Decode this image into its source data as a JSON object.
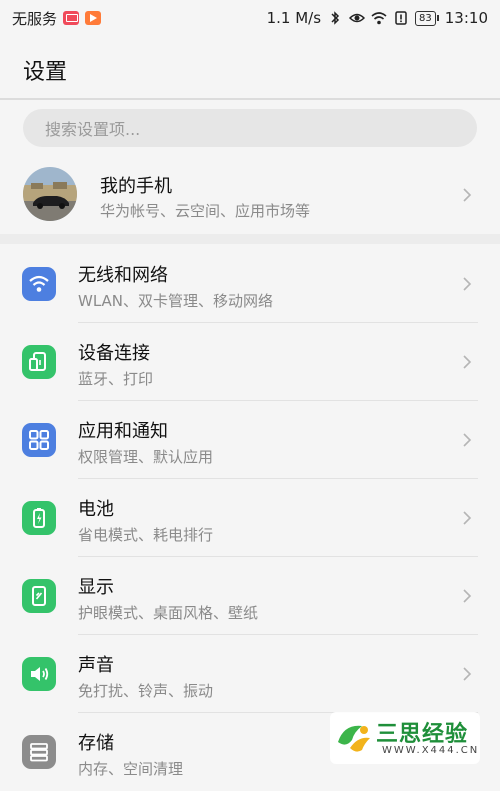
{
  "status_bar": {
    "carrier": "无服务",
    "speed": "1.1 M/s",
    "battery": "83",
    "time": "13:10"
  },
  "header": {
    "title": "设置"
  },
  "search": {
    "placeholder": "搜索设置项..."
  },
  "profile": {
    "name": "我的手机",
    "subtitle": "华为帐号、云空间、应用市场等"
  },
  "items": [
    {
      "title": "无线和网络",
      "subtitle": "WLAN、双卡管理、移动网络",
      "icon": "wifi-icon",
      "color": "#4d7fe0"
    },
    {
      "title": "设备连接",
      "subtitle": "蓝牙、打印",
      "icon": "device-connection-icon",
      "color": "#34c36a"
    },
    {
      "title": "应用和通知",
      "subtitle": "权限管理、默认应用",
      "icon": "apps-grid-icon",
      "color": "#4d7fe0"
    },
    {
      "title": "电池",
      "subtitle": "省电模式、耗电排行",
      "icon": "battery-icon",
      "color": "#34c36a"
    },
    {
      "title": "显示",
      "subtitle": "护眼模式、桌面风格、壁纸",
      "icon": "display-icon",
      "color": "#34c36a"
    },
    {
      "title": "声音",
      "subtitle": "免打扰、铃声、振动",
      "icon": "speaker-icon",
      "color": "#34c36a"
    },
    {
      "title": "存储",
      "subtitle": "内存、空间清理",
      "icon": "storage-icon",
      "color": "#8c8c8c"
    }
  ],
  "watermark": {
    "name": "三思经验",
    "url": "WWW.X444.CN"
  }
}
